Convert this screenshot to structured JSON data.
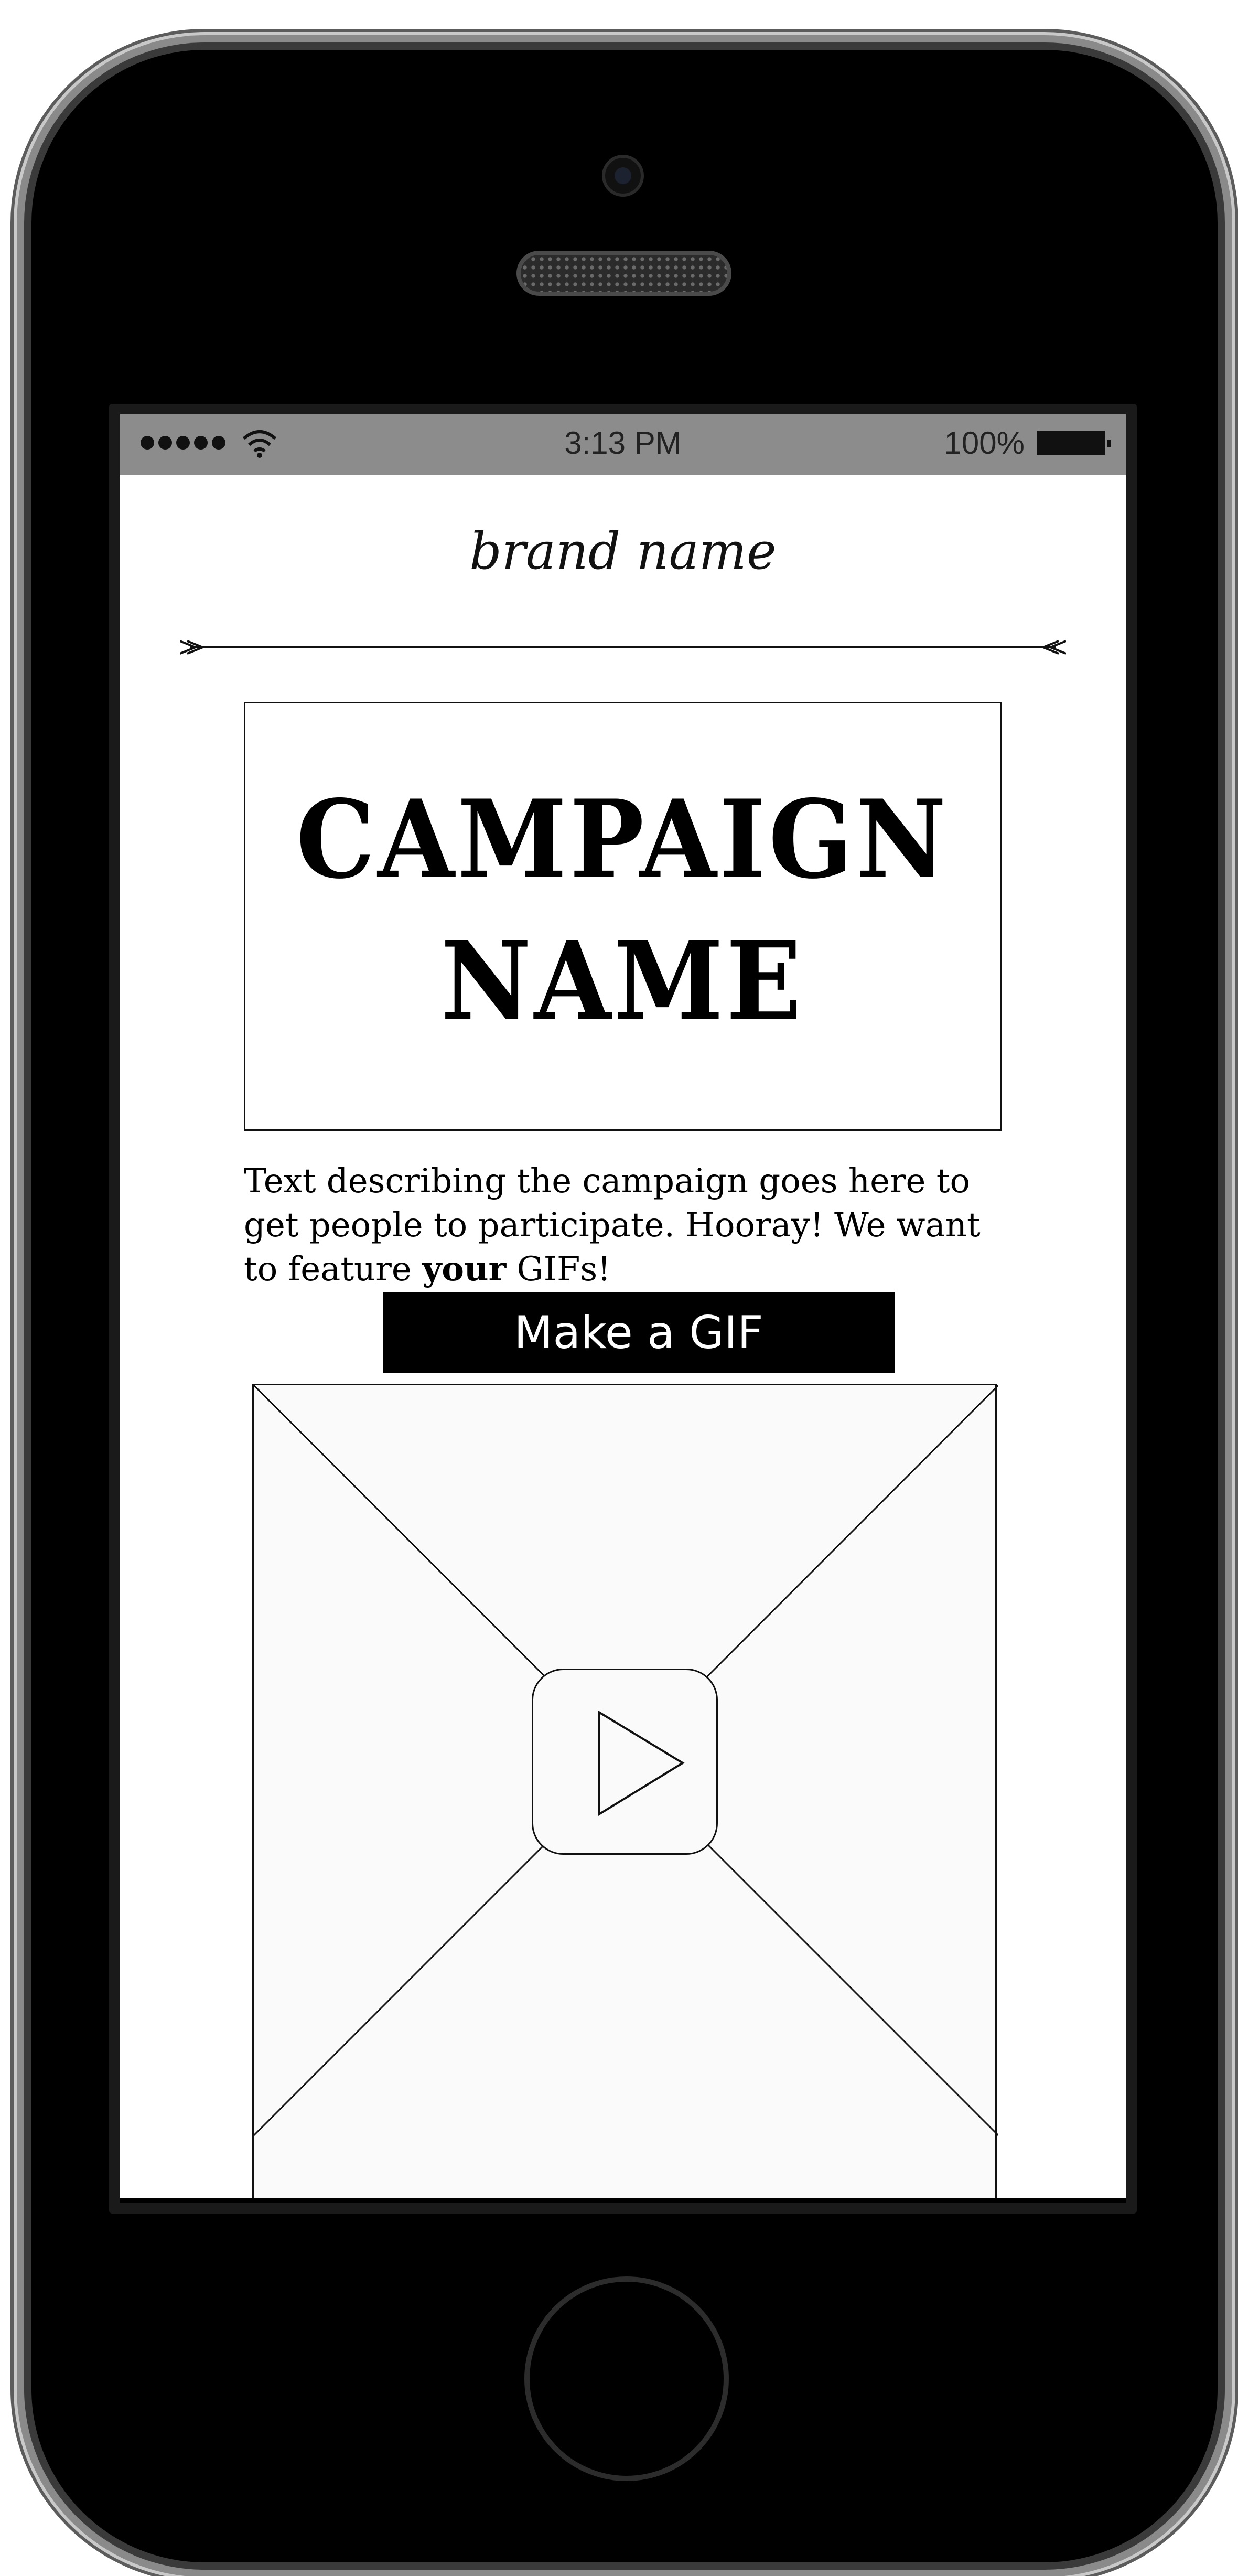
{
  "status_bar": {
    "time": "3:13 PM",
    "battery_percent": "100%",
    "signal_icon": "signal-dots-icon",
    "wifi_icon": "wifi-icon",
    "battery_icon": "battery-icon"
  },
  "header": {
    "brand_name": "brand name",
    "divider_icon": "arrow-divider-icon"
  },
  "campaign": {
    "title_line1": "CAMPAIGN",
    "title_line2": "NAME"
  },
  "description": {
    "part1": "Text describing the campaign goes here to get people to participate. Hooray! We want to feature ",
    "emphasis": "your",
    "part2": " GIFs!"
  },
  "cta": {
    "label": "Make a GIF"
  },
  "media": {
    "play_icon": "play-icon",
    "placeholder": "video-placeholder"
  },
  "colors": {
    "status_bar_bg": "#8c8c8c",
    "button_bg": "#000000",
    "button_text": "#ffffff",
    "phone_body": "#000000"
  }
}
